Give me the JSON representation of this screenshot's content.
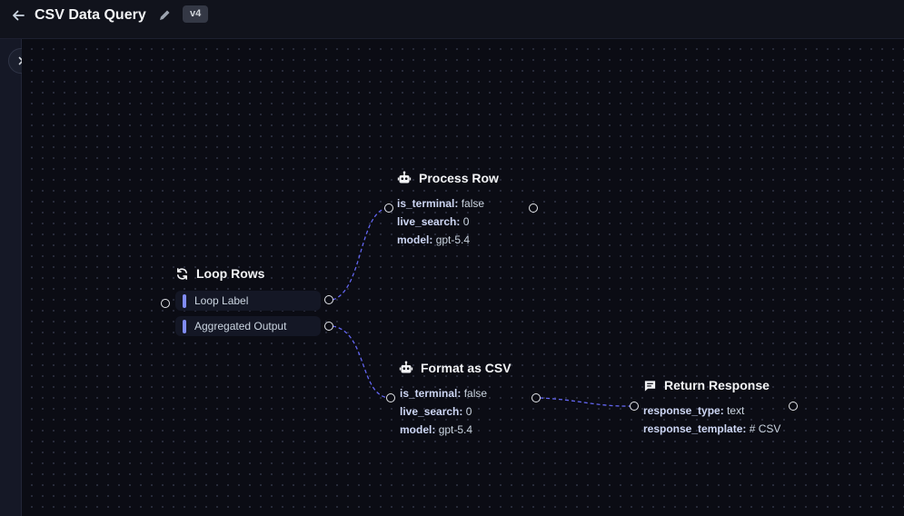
{
  "header": {
    "title": "CSV Data Query",
    "version": "v4"
  },
  "nodes": {
    "process_row": {
      "title": "Process Row",
      "fields": [
        {
          "key": "is_terminal:",
          "value": "false"
        },
        {
          "key": "live_search:",
          "value": "0"
        },
        {
          "key": "model:",
          "value": "gpt-5.4"
        }
      ]
    },
    "loop_rows": {
      "title": "Loop Rows",
      "items": [
        "Loop Label",
        "Aggregated Output"
      ]
    },
    "format_csv": {
      "title": "Format as CSV",
      "fields": [
        {
          "key": "is_terminal:",
          "value": "false"
        },
        {
          "key": "live_search:",
          "value": "0"
        },
        {
          "key": "model:",
          "value": "gpt-5.4"
        }
      ]
    },
    "return_response": {
      "title": "Return Response",
      "fields": [
        {
          "key": "response_type:",
          "value": "text"
        },
        {
          "key": "response_template:",
          "value": "# CSV"
        }
      ]
    }
  },
  "colors": {
    "edge": "#6366f1",
    "accent": "#818cf8",
    "background": "#0b0c14"
  }
}
